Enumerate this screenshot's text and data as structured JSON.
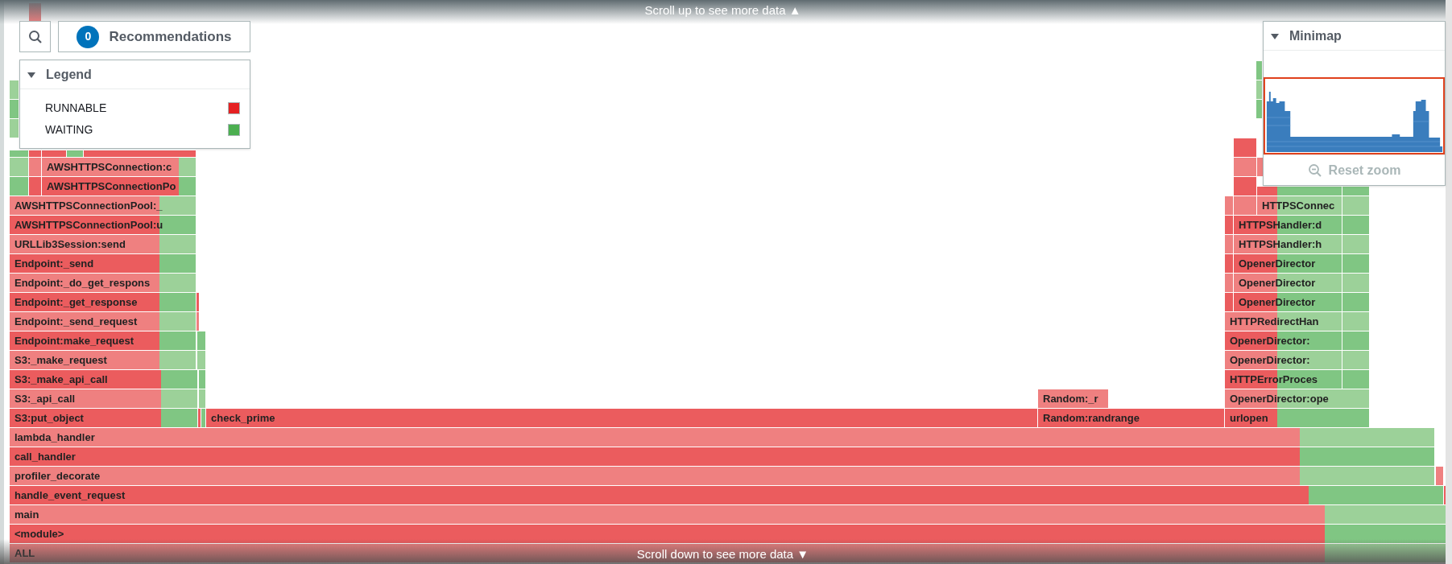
{
  "scroll_up_hint": "Scroll up to see more data ▲",
  "toolbar": {
    "recommendations": {
      "count": "0",
      "label": "Recommendations"
    }
  },
  "legend": {
    "title": "Legend",
    "expanded": true,
    "items": [
      {
        "label": "RUNNABLE",
        "color": "#e52122"
      },
      {
        "label": "WAITING",
        "color": "#4caf50"
      }
    ]
  },
  "minimap": {
    "title": "Minimap",
    "expanded": true,
    "reset_zoom": {
      "label": "Reset zoom",
      "disabled": true
    }
  },
  "flame_rows": [
    {
      "frames": [
        "AWSHTTPSConnection:c"
      ]
    },
    {
      "frames": [
        "AWSHTTPSConnectionPo"
      ]
    },
    {
      "frames": [
        "AWSHTTPSConnectionPool:_",
        "HTTPSConnec"
      ]
    },
    {
      "frames": [
        "AWSHTTPSConnectionPool:u",
        "HTTPSHandler:d"
      ]
    },
    {
      "frames": [
        "URLLib3Session:send",
        "HTTPSHandler:h"
      ]
    },
    {
      "frames": [
        "Endpoint:_send",
        "OpenerDirector"
      ]
    },
    {
      "frames": [
        "Endpoint:_do_get_respons",
        "OpenerDirector"
      ]
    },
    {
      "frames": [
        "Endpoint:_get_response",
        "OpenerDirector"
      ]
    },
    {
      "frames": [
        "Endpoint:_send_request",
        "HTTPRedirectHan"
      ]
    },
    {
      "frames": [
        "Endpoint:make_request",
        "OpenerDirector:"
      ]
    },
    {
      "frames": [
        "S3:_make_request",
        "OpenerDirector:"
      ]
    },
    {
      "frames": [
        "S3:_make_api_call",
        "HTTPErrorProces"
      ]
    },
    {
      "frames": [
        "S3:_api_call",
        "Random:_r",
        "OpenerDirector:ope"
      ]
    },
    {
      "frames": [
        "S3:put_object",
        "check_prime",
        "Random:randrange",
        "urlopen"
      ]
    },
    {
      "frames": [
        "lambda_handler"
      ]
    },
    {
      "frames": [
        "call_handler"
      ]
    },
    {
      "frames": [
        "profiler_decorate"
      ]
    },
    {
      "frames": [
        "handle_event_request"
      ]
    },
    {
      "frames": [
        "main"
      ]
    },
    {
      "frames": [
        "<module>"
      ]
    },
    {
      "frames": [
        "ALL"
      ]
    }
  ],
  "scroll_down_hint": "Scroll down to see more data ▼"
}
